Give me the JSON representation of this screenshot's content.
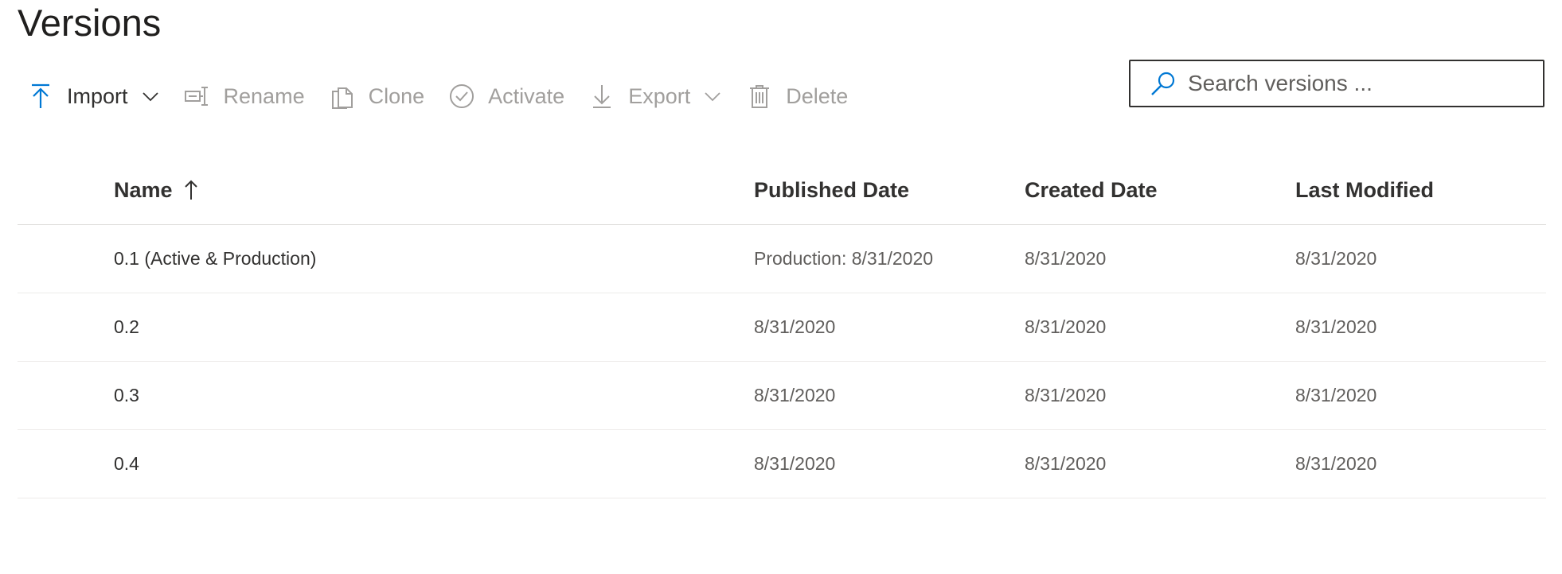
{
  "page": {
    "title": "Versions"
  },
  "toolbar": {
    "import_label": "Import",
    "rename_label": "Rename",
    "clone_label": "Clone",
    "activate_label": "Activate",
    "export_label": "Export",
    "delete_label": "Delete"
  },
  "search": {
    "placeholder": "Search versions ..."
  },
  "table": {
    "columns": {
      "name": "Name",
      "published": "Published Date",
      "created": "Created Date",
      "modified": "Last Modified"
    },
    "sort": {
      "column": "Name",
      "direction": "ascending"
    },
    "rows": [
      {
        "name": "0.1 (Active & Production)",
        "published": "Production: 8/31/2020",
        "created": "8/31/2020",
        "modified": "8/31/2020"
      },
      {
        "name": "0.2",
        "published": "8/31/2020",
        "created": "8/31/2020",
        "modified": "8/31/2020"
      },
      {
        "name": "0.3",
        "published": "8/31/2020",
        "created": "8/31/2020",
        "modified": "8/31/2020"
      },
      {
        "name": "0.4",
        "published": "8/31/2020",
        "created": "8/31/2020",
        "modified": "8/31/2020"
      }
    ]
  },
  "colors": {
    "accent": "#0078d4",
    "text": "#323130",
    "disabled": "#a19f9d",
    "border": "#edebe9"
  },
  "icons": {
    "import": "upload-arrow-icon",
    "rename": "rename-icon",
    "clone": "copy-icon",
    "activate": "check-circle-icon",
    "export": "download-arrow-icon",
    "delete": "trash-icon",
    "search": "search-icon",
    "sort": "sort-up-arrow-icon"
  }
}
